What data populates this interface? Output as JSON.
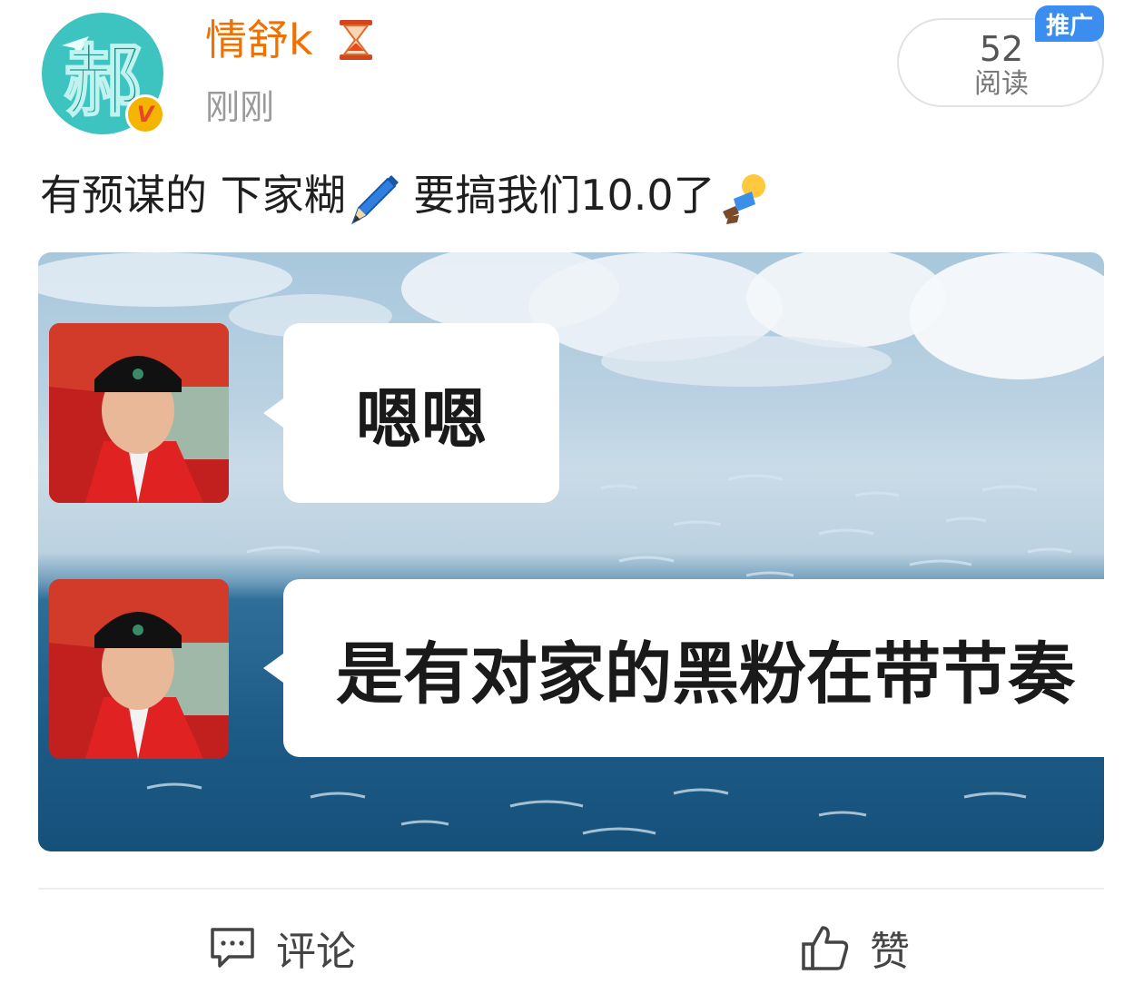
{
  "user": {
    "avatar_char": "郝",
    "name": "情舒k",
    "verified_badge": "V",
    "time": "刚刚",
    "status_icon": "hourglass-icon"
  },
  "read": {
    "count": "52",
    "label": "阅读"
  },
  "promo_tag": "推广",
  "post": {
    "text_part1": "有预谋的 下家糊",
    "text_part2": " 要搞我们10.0了",
    "emojis": [
      "pen-emoji",
      "falling-man-emoji"
    ]
  },
  "image": {
    "bubble1": "嗯嗯",
    "bubble2": "是有对家的黑粉在带节奏"
  },
  "actions": {
    "comment": "评论",
    "like": "赞"
  },
  "colors": {
    "username": "#f07000",
    "promo": "#3b8ef0",
    "sea": "#1c5b86",
    "avatar_bg": "#3dc4c0"
  }
}
